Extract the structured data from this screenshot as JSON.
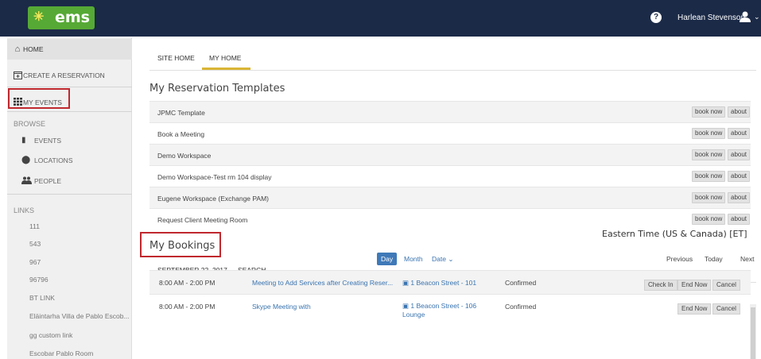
{
  "header": {
    "logo_text": "ems",
    "help_icon": "question-circle-icon",
    "user_name": "Harlean Stevenson",
    "user_icon": "user-icon"
  },
  "sidebar": {
    "home": "HOME",
    "create_reservation": "CREATE A RESERVATION",
    "my_events": "MY EVENTS",
    "browse_heading": "BROWSE",
    "browse_items": [
      "EVENTS",
      "LOCATIONS",
      "PEOPLE"
    ],
    "links_heading": "LINKS",
    "links": [
      "111",
      "543",
      "967",
      "96796",
      "BT LINK",
      "Eläintarha Villa de Pablo Escob...",
      "gg custom link",
      "Escobar Pablo Room"
    ]
  },
  "tabs": {
    "site_home": "SITE HOME",
    "my_home": "MY HOME"
  },
  "templates": {
    "heading": "My Reservation Templates",
    "book_now_label": "book now",
    "about_label": "about",
    "items": [
      "JPMC Template",
      "Book a Meeting",
      "Demo Workspace",
      "Demo Workspace-Test rm 104 display",
      "Eugene Workspace (Exchange PAM)",
      "Request Client Meeting Room"
    ]
  },
  "bookings": {
    "heading": "My Bookings",
    "date_tab": "SEPTEMBER 22, 2017",
    "search_tab": "SEARCH",
    "timezone": "Eastern Time (US & Canada) [ET]",
    "views": {
      "day": "Day",
      "month": "Month",
      "date": "Date ⌄"
    },
    "nav": {
      "previous": "Previous",
      "today": "Today",
      "next": "Next"
    },
    "rows": [
      {
        "time": "8:00 AM - 2:00 PM",
        "title": "Meeting to Add Services after Creating Reser...",
        "location_line1": "1 Beacon Street - 101",
        "location_line2": "",
        "status": "Confirmed",
        "buttons": [
          "Check In",
          "End Now",
          "Cancel"
        ]
      },
      {
        "time": "8:00 AM - 2:00 PM",
        "title": "Skype Meeting with",
        "location_line1": "1 Beacon Street - 106",
        "location_line2": "Lounge",
        "status": "Confirmed",
        "buttons": [
          "End Now",
          "Cancel"
        ]
      }
    ]
  },
  "colors": {
    "topbar": "#1b2a47",
    "logo": "#56a935",
    "accent_underline": "#d9b535",
    "highlight": "#c0282e",
    "link": "#3a74b0"
  }
}
